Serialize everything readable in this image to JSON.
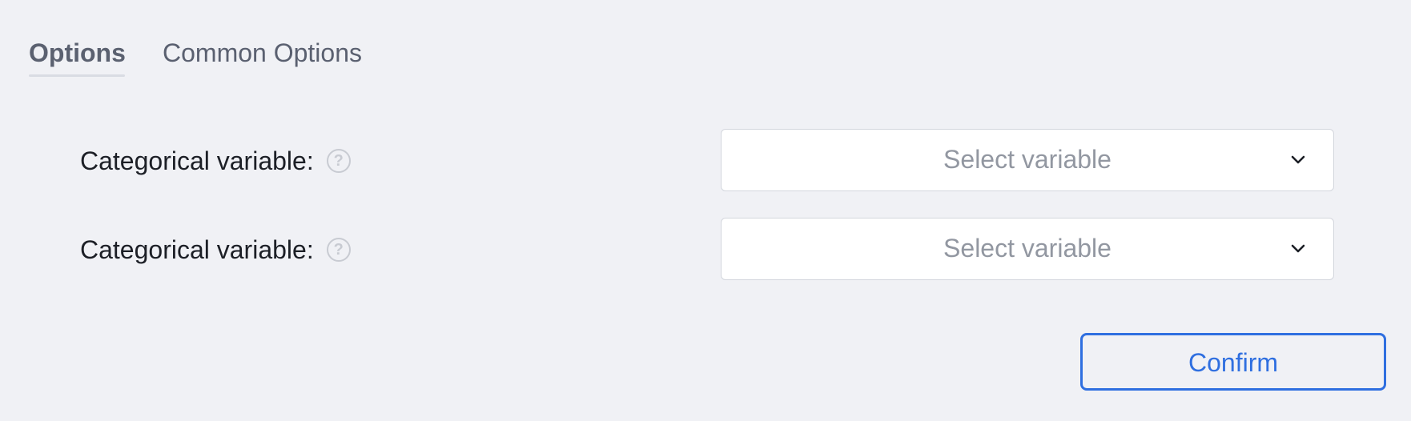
{
  "tabs": [
    {
      "label": "Options",
      "active": true
    },
    {
      "label": "Common Options",
      "active": false
    }
  ],
  "form": {
    "rows": [
      {
        "label": "Categorical variable:",
        "help_icon": "question-circle-icon",
        "select_placeholder": "Select variable"
      },
      {
        "label": "Categorical variable:",
        "help_icon": "question-circle-icon",
        "select_placeholder": "Select variable"
      }
    ]
  },
  "actions": {
    "confirm_label": "Confirm"
  },
  "colors": {
    "background": "#f0f1f5",
    "accent": "#2f6fe0",
    "placeholder": "#9297a1",
    "help_icon": "#c8cbd2"
  }
}
